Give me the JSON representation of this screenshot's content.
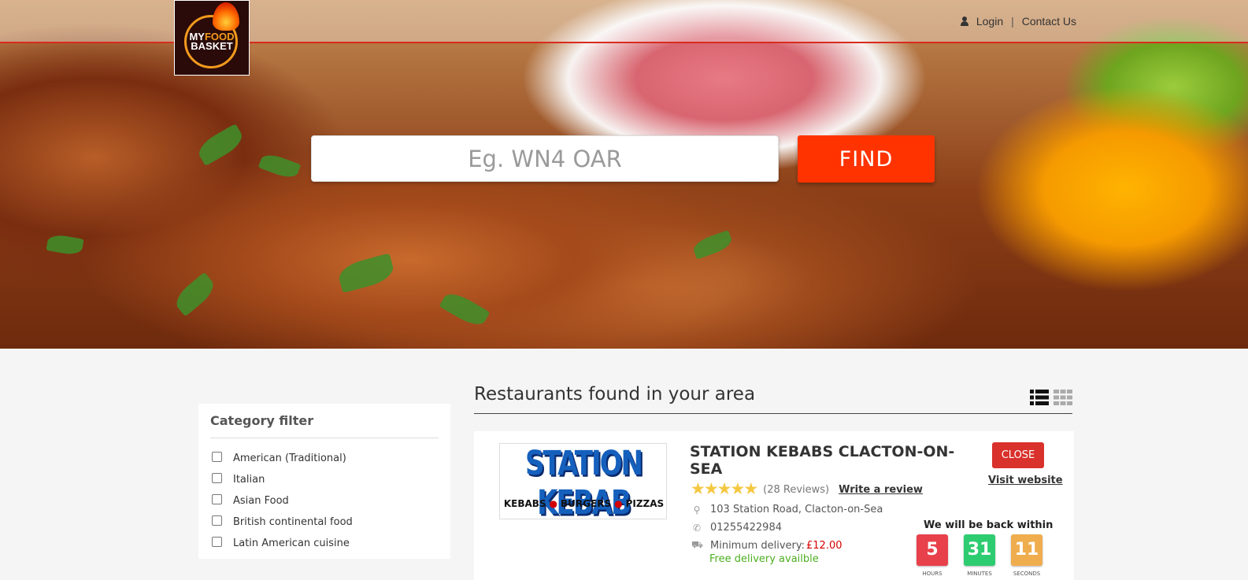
{
  "header": {
    "logo_text_line1": "MY",
    "logo_text_food": "FOOD",
    "logo_text_line2": "BASKET",
    "login_label": "Login",
    "separator": "|",
    "contact_label": "Contact Us"
  },
  "search": {
    "placeholder": "Eg. WN4 OAR",
    "value": "",
    "find_label": "FIND"
  },
  "sidebar": {
    "title": "Category filter",
    "categories": [
      {
        "label": "American (Traditional)",
        "checked": false
      },
      {
        "label": "Italian",
        "checked": false
      },
      {
        "label": "Asian Food",
        "checked": false
      },
      {
        "label": "British continental food",
        "checked": false
      },
      {
        "label": "Latin American cuisine",
        "checked": false
      }
    ]
  },
  "main": {
    "title": "Restaurants found in your area",
    "view_modes": [
      "list-view-icon",
      "grid-view-icon"
    ]
  },
  "restaurant": {
    "logo_title": "STATION KEBAB",
    "logo_items": [
      "KEBABS",
      "BURGERS",
      "PIZZAS"
    ],
    "name": "STATION KEBABS CLACTON-ON-SEA",
    "rating": 5,
    "reviews": "(28 Reviews)",
    "write_review": "Write a review",
    "address": "103 Station Road, Clacton-on-Sea",
    "phone": "01255422984",
    "min_delivery_label": "Minimum delivery:",
    "min_delivery_value": "£12.00",
    "free_delivery": "Free delivery availble",
    "status_button": "CLOSE",
    "visit_website": "Visit website",
    "back_within": "We will be back within",
    "countdown": [
      {
        "value": "5",
        "label": "HOURS",
        "color": "#e8414b"
      },
      {
        "value": "31",
        "label": "MINUTES",
        "color": "#2ecc71"
      },
      {
        "value": "11",
        "label": "SECONDS",
        "color": "#f0ad4e"
      }
    ]
  },
  "colors": {
    "accent": "#ff3300",
    "close": "#d9312b",
    "price": "#d60000",
    "free": "#4caf20"
  }
}
